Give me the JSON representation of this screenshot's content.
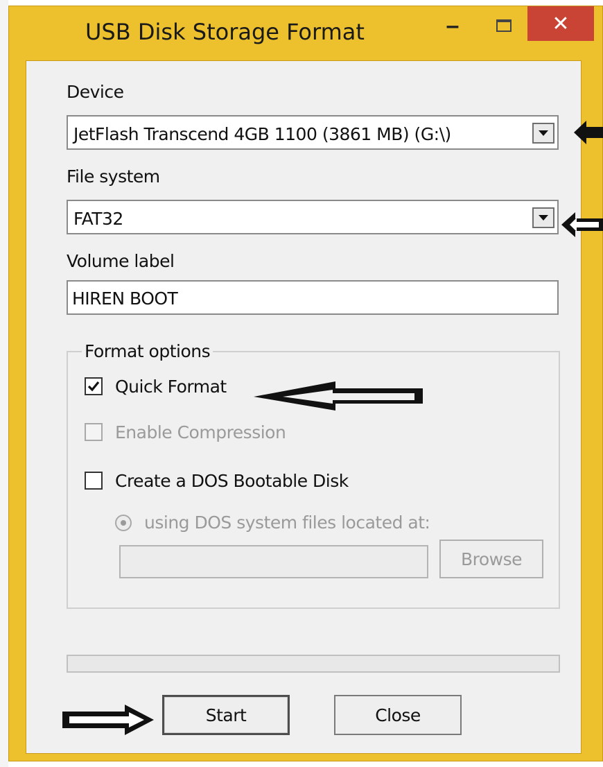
{
  "window": {
    "title": "USB Disk Storage Format",
    "minimize_label": "–",
    "close_label": "✕"
  },
  "device": {
    "label": "Device",
    "selected": "JetFlash Transcend 4GB 1100 (3861 MB) (G:\\)"
  },
  "file_system": {
    "label": "File system",
    "selected": "FAT32"
  },
  "volume_label": {
    "label": "Volume label",
    "value": "HIREN BOOT"
  },
  "format_options": {
    "title": "Format options",
    "quick_format": {
      "label": "Quick Format",
      "checked": true
    },
    "enable_compression": {
      "label": "Enable Compression",
      "checked": false,
      "enabled": false
    },
    "dos_bootable": {
      "label": "Create a DOS Bootable Disk",
      "checked": false
    },
    "dos_files_radio": {
      "label": "using DOS system files located at:",
      "enabled": false
    },
    "dos_path": {
      "value": ""
    },
    "browse_label": "Browse"
  },
  "progress": {
    "value": 0
  },
  "buttons": {
    "start_label": "Start",
    "close_label": "Close"
  },
  "colors": {
    "frame": "#ecc12d",
    "close_button": "#c94434",
    "client": "#f0f0f0"
  }
}
